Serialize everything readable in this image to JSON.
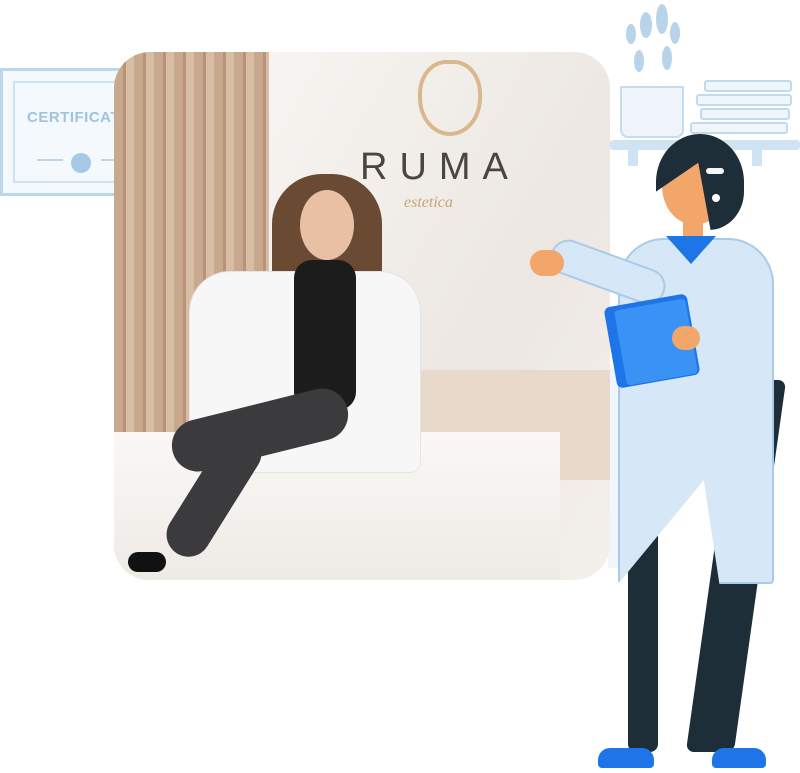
{
  "certificate": {
    "title": "CERTIFICAT"
  },
  "photo": {
    "brand_text": "RUMA",
    "brand_script": "estetica"
  },
  "colors": {
    "accent_blue": "#1d75e8",
    "light_blue": "#d6e7f7",
    "dark_navy": "#1e2e38",
    "skin": "#f2a66a",
    "gold": "#d9b98c"
  }
}
